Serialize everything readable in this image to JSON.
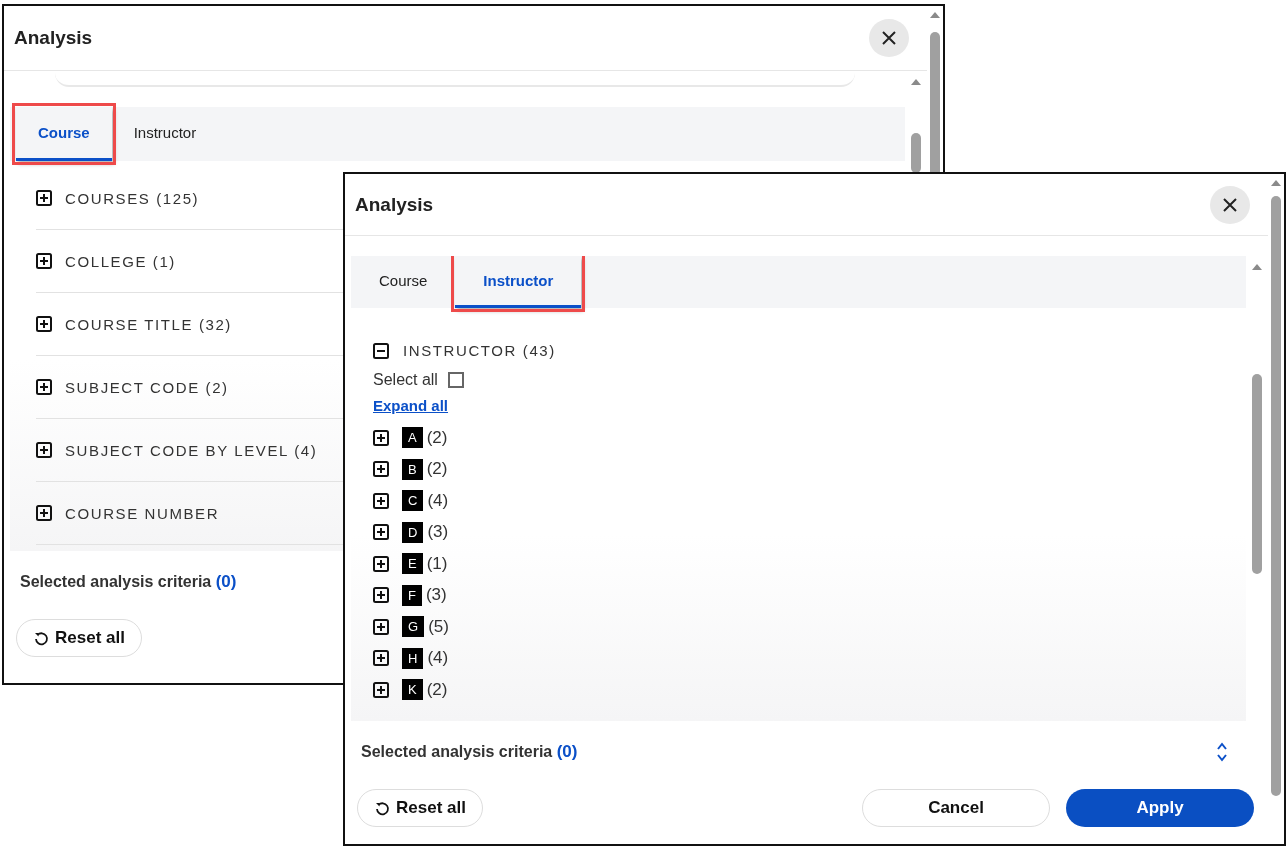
{
  "windows": [
    {
      "title": "Analysis",
      "tabs": [
        {
          "label": "Course",
          "selected": true,
          "highlighted": true
        },
        {
          "label": "Instructor",
          "selected": false,
          "highlighted": false
        }
      ],
      "filters": [
        {
          "label": "COURSES (125)",
          "expanded": false
        },
        {
          "label": "COLLEGE (1)",
          "expanded": false
        },
        {
          "label": "COURSE TITLE (32)",
          "expanded": false
        },
        {
          "label": "SUBJECT CODE (2)",
          "expanded": false
        },
        {
          "label": "SUBJECT CODE BY LEVEL (4)",
          "expanded": false
        },
        {
          "label": "COURSE NUMBER",
          "expanded": false
        }
      ],
      "footer": {
        "criteria_label": "Selected analysis criteria",
        "criteria_count": "(0)",
        "buttons": [
          {
            "label": "Reset all",
            "kind": "reset"
          }
        ]
      }
    },
    {
      "title": "Analysis",
      "tabs": [
        {
          "label": "Course",
          "selected": false,
          "highlighted": false
        },
        {
          "label": "Instructor",
          "selected": true,
          "highlighted": true
        }
      ],
      "filters": [
        {
          "label": "INSTRUCTOR (43)",
          "expanded": true,
          "select_all": {
            "label": "Select all",
            "checked": false
          },
          "expand_all": "Expand all",
          "children": [
            {
              "letter": "A",
              "count": "(2)",
              "expanded": false
            },
            {
              "letter": "B",
              "count": "(2)",
              "expanded": false
            },
            {
              "letter": "C",
              "count": "(4)",
              "expanded": false
            },
            {
              "letter": "D",
              "count": "(3)",
              "expanded": false
            },
            {
              "letter": "E",
              "count": "(1)",
              "expanded": false
            },
            {
              "letter": "F",
              "count": "(3)",
              "expanded": false
            },
            {
              "letter": "G",
              "count": "(5)",
              "expanded": false
            },
            {
              "letter": "H",
              "count": "(4)",
              "expanded": false
            },
            {
              "letter": "K",
              "count": "(2)",
              "expanded": false
            }
          ]
        }
      ],
      "footer": {
        "criteria_label": "Selected analysis criteria",
        "criteria_count": "(0)",
        "buttons": [
          {
            "label": "Reset all",
            "kind": "reset"
          },
          {
            "label": "Cancel",
            "kind": "secondary"
          },
          {
            "label": "Apply",
            "kind": "primary"
          }
        ]
      }
    }
  ]
}
